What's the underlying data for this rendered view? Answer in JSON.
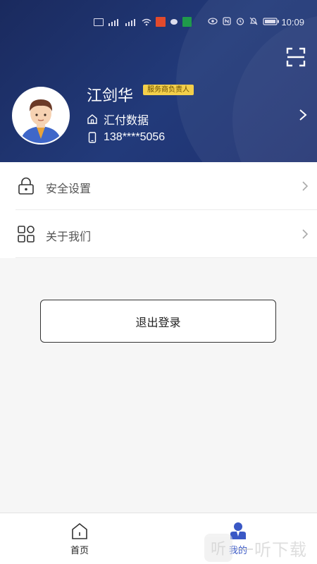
{
  "status_bar": {
    "time": "10:09",
    "battery_text": "▭"
  },
  "profile": {
    "name": "江剑华",
    "role_badge": "服务商负责人",
    "company": "汇付数据",
    "phone": "138****5056"
  },
  "menu": {
    "items": [
      {
        "label": "安全设置",
        "icon": "lock-icon"
      },
      {
        "label": "关于我们",
        "icon": "grid-icon"
      }
    ]
  },
  "logout": {
    "label": "退出登录"
  },
  "tabbar": {
    "items": [
      {
        "label": "首页",
        "icon": "home-icon",
        "active": false
      },
      {
        "label": "我的",
        "icon": "user-icon",
        "active": true
      }
    ]
  },
  "watermark": {
    "text": "一听下载",
    "logo_text": "听"
  },
  "colors": {
    "header_bg": "#1f3170",
    "badge_bg": "#f3cf4a",
    "active_tab": "#3a58c5"
  }
}
